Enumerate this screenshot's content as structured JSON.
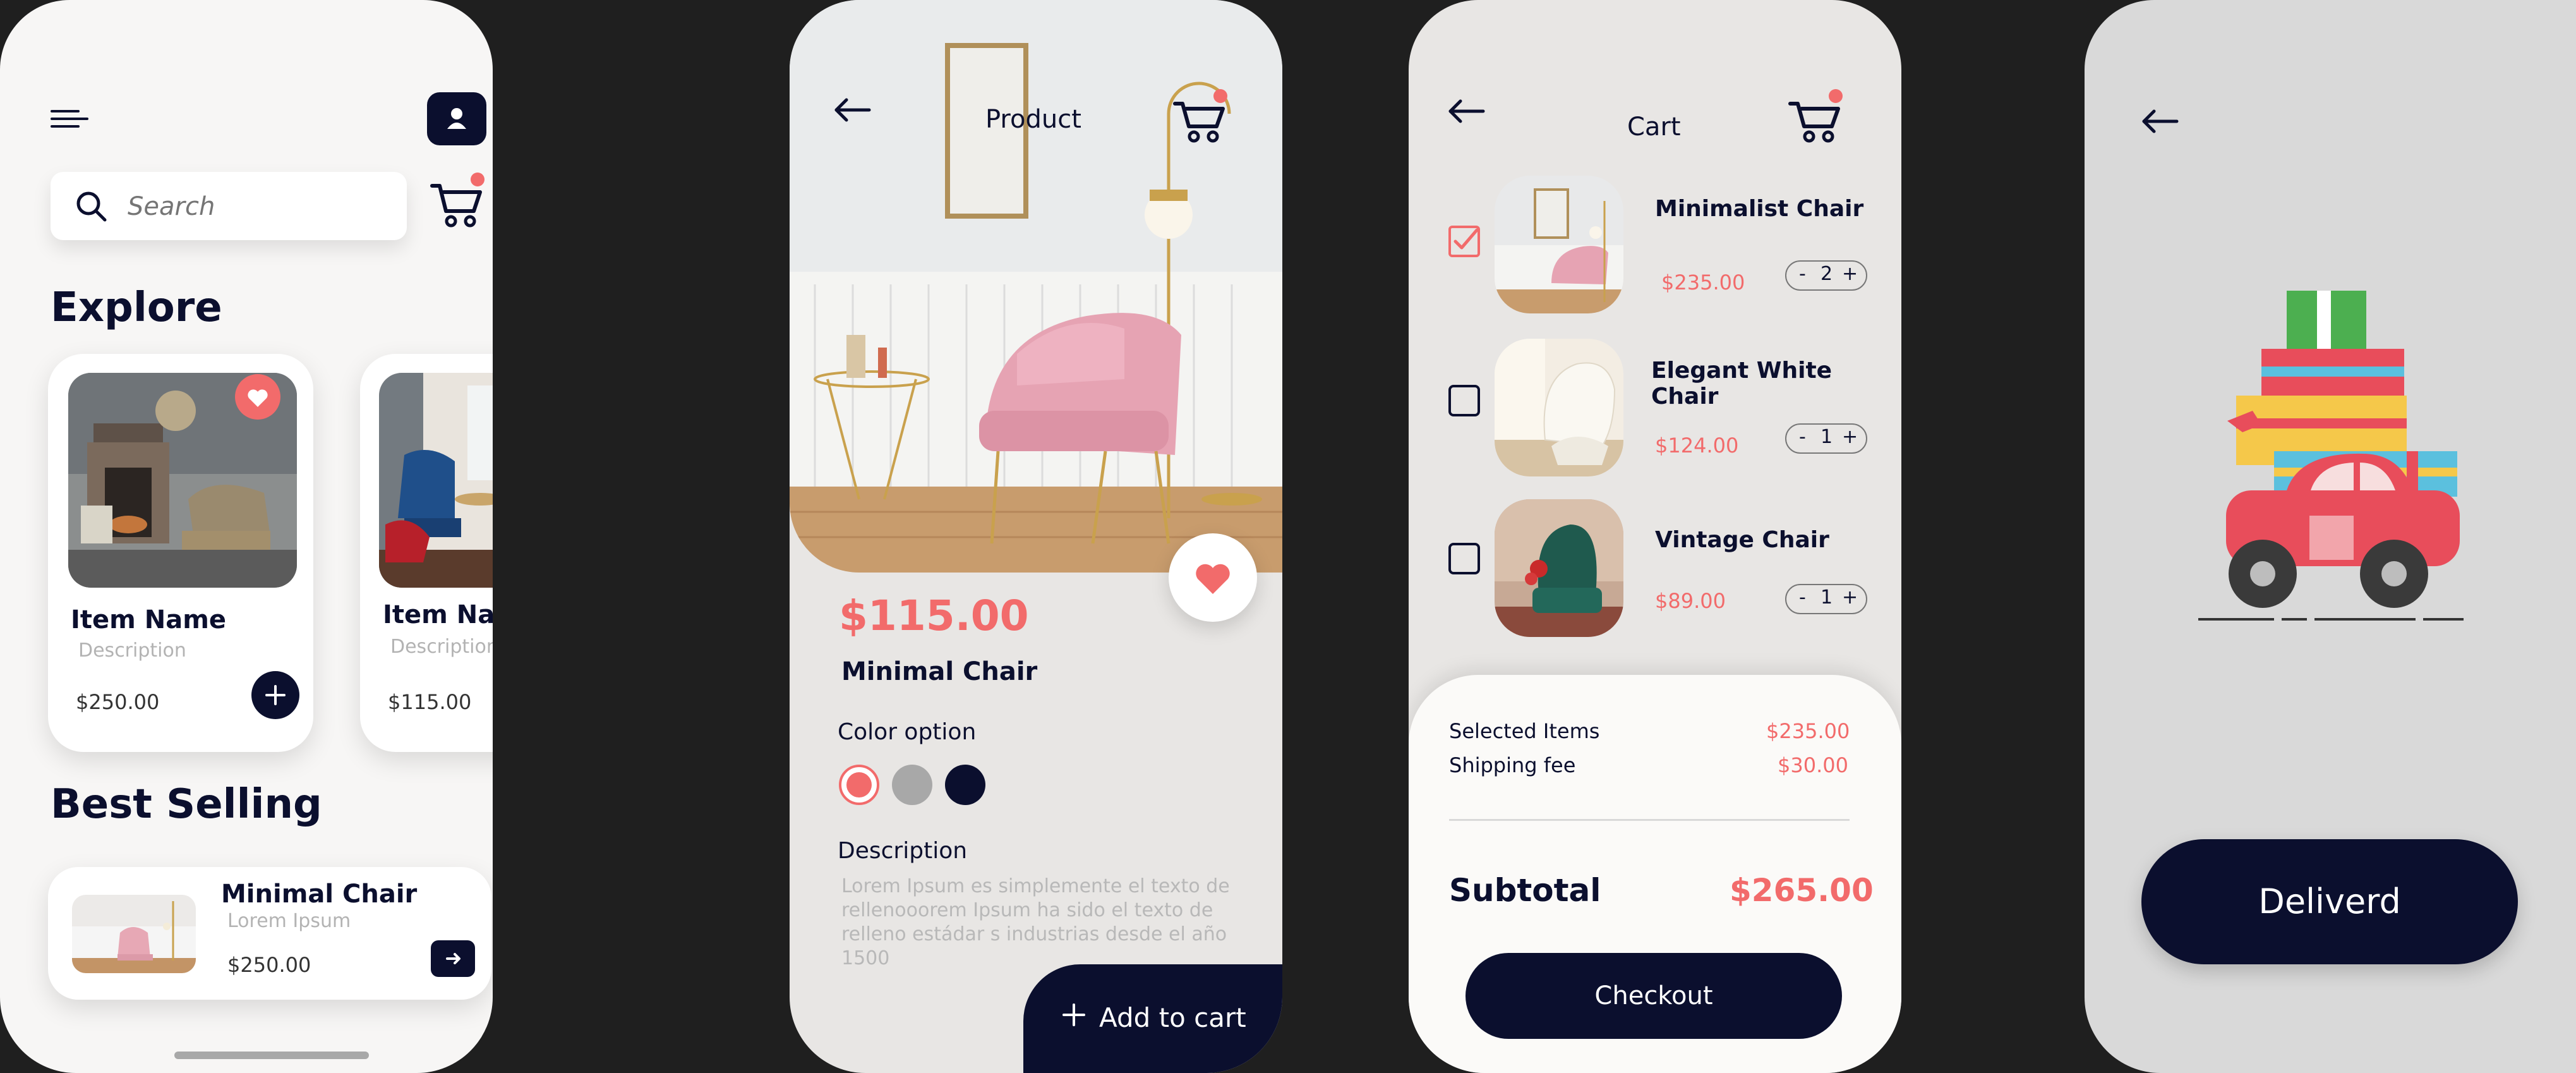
{
  "colors": {
    "navy": "#0b0f2e",
    "coral": "#f26b6b",
    "swatch_gray": "#a8a8a8",
    "page_bg": "#1f1f1f"
  },
  "explore_screen": {
    "menu_icon": "menu-lines-icon",
    "profile_icon": "user-icon",
    "search": {
      "placeholder": "Search",
      "icon": "search-icon"
    },
    "cart_icon": "cart-icon",
    "explore_heading": "Explore",
    "cards": [
      {
        "name": "Item Name",
        "description": "Description",
        "price": "$250.00",
        "favorited": true
      },
      {
        "name": "Item Name",
        "description": "Description",
        "price": "$115.00",
        "favorited": false
      }
    ],
    "best_selling_heading": "Best Selling",
    "best_selling": {
      "name": "Minimal Chair",
      "subtitle": "Lorem Ipsum",
      "price": "$250.00"
    }
  },
  "product_screen": {
    "title": "Product",
    "price": "$115.00",
    "name": "Minimal Chair",
    "color_option_label": "Color option",
    "color_options": [
      "#f26b6b",
      "#a8a8a8",
      "#0b0f2e"
    ],
    "selected_color_index": 0,
    "description_label": "Description",
    "description": "Lorem Ipsum es simplemente el texto de rellenooorem Ipsum ha sido el texto de relleno estádar s industrias desde el año 1500",
    "add_to_cart_label": "Add to cart"
  },
  "cart_screen": {
    "title": "Cart",
    "items": [
      {
        "name": "Minimalist Chair",
        "price": "$235.00",
        "qty": "2",
        "checked": true
      },
      {
        "name": "Elegant White Chair",
        "price": "$124.00",
        "qty": "1",
        "checked": false
      },
      {
        "name": "Vintage Chair",
        "price": "$89.00",
        "qty": "1",
        "checked": false
      }
    ],
    "qty_minus": "-",
    "qty_plus": "+",
    "summary": {
      "selected_items_label": "Selected Items",
      "selected_items_value": "$235.00",
      "shipping_label": "Shipping fee",
      "shipping_value": "$30.00",
      "subtotal_label": "Subtotal",
      "subtotal_value": "$265.00"
    },
    "checkout_label": "Checkout"
  },
  "delivered_screen": {
    "button_label": "Deliverd"
  }
}
